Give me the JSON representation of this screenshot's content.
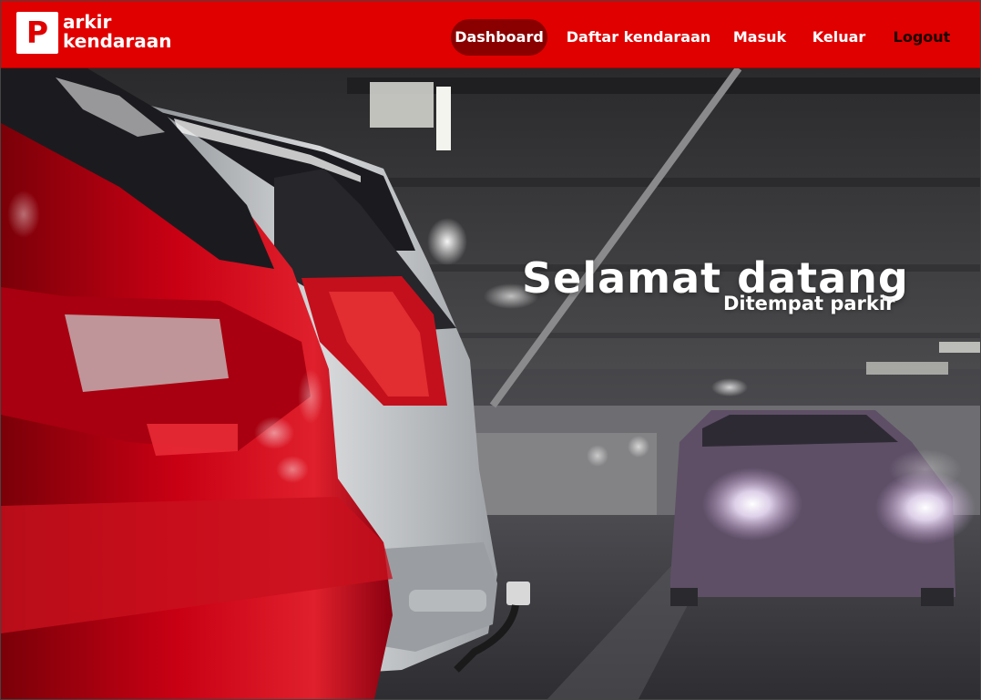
{
  "brand": {
    "logo_letter": "P",
    "line1": "arkir",
    "line2": "kendaraan",
    "color": "#e00000"
  },
  "nav": {
    "items": [
      {
        "label": "Dashboard",
        "active": true
      },
      {
        "label": "Daftar kendaraan",
        "active": false
      },
      {
        "label": "Masuk",
        "active": false
      },
      {
        "label": "Keluar",
        "active": false
      },
      {
        "label": "Logout",
        "active": false
      }
    ],
    "active_color": "#8a0000"
  },
  "hero": {
    "title": "Selamat datang",
    "subtitle": "Ditempat parkir",
    "image": "parking-garage-photo"
  }
}
